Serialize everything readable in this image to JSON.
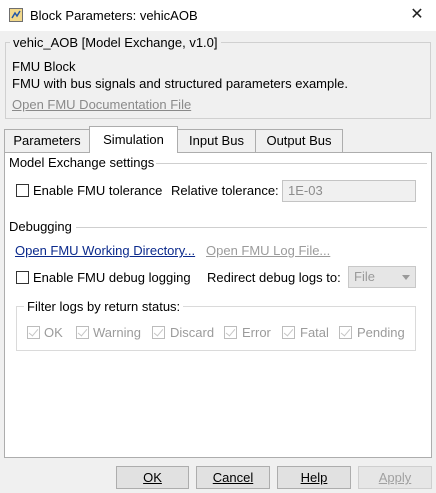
{
  "window": {
    "title": "Block Parameters: vehicAOB",
    "close_glyph": "✕"
  },
  "header": {
    "group_title": "vehic_AOB [Model Exchange, v1.0]",
    "block_type": "FMU Block",
    "description": "FMU with bus signals and structured parameters example.",
    "doc_link": "Open FMU Documentation File"
  },
  "tabs": [
    {
      "label": "Parameters",
      "active": false
    },
    {
      "label": "Simulation",
      "active": true
    },
    {
      "label": "Input Bus",
      "active": false
    },
    {
      "label": "Output Bus",
      "active": false
    }
  ],
  "model_exchange": {
    "section_title": "Model Exchange settings",
    "enable_tolerance_label": "Enable FMU tolerance",
    "enable_tolerance_checked": false,
    "relative_tolerance_label": "Relative tolerance:",
    "relative_tolerance_value": "1E-03"
  },
  "debugging": {
    "section_title": "Debugging",
    "working_dir_link": "Open FMU Working Directory...",
    "log_file_link": "Open FMU Log File...",
    "enable_debug_label": "Enable FMU debug logging",
    "enable_debug_checked": false,
    "redirect_label": "Redirect debug logs to:",
    "redirect_value": "File"
  },
  "filter": {
    "title": "Filter logs by return status:",
    "items": [
      {
        "label": "OK",
        "checked": true
      },
      {
        "label": "Warning",
        "checked": true
      },
      {
        "label": "Discard",
        "checked": true
      },
      {
        "label": "Error",
        "checked": true
      },
      {
        "label": "Fatal",
        "checked": true
      },
      {
        "label": "Pending",
        "checked": true
      }
    ]
  },
  "buttons": {
    "ok": "OK",
    "cancel": "Cancel",
    "help": "Help",
    "apply": "Apply"
  },
  "colors": {
    "link": "#0b2a8c",
    "disabled_text": "#9b9b9b",
    "dialog_bg": "#f0f0f0"
  }
}
